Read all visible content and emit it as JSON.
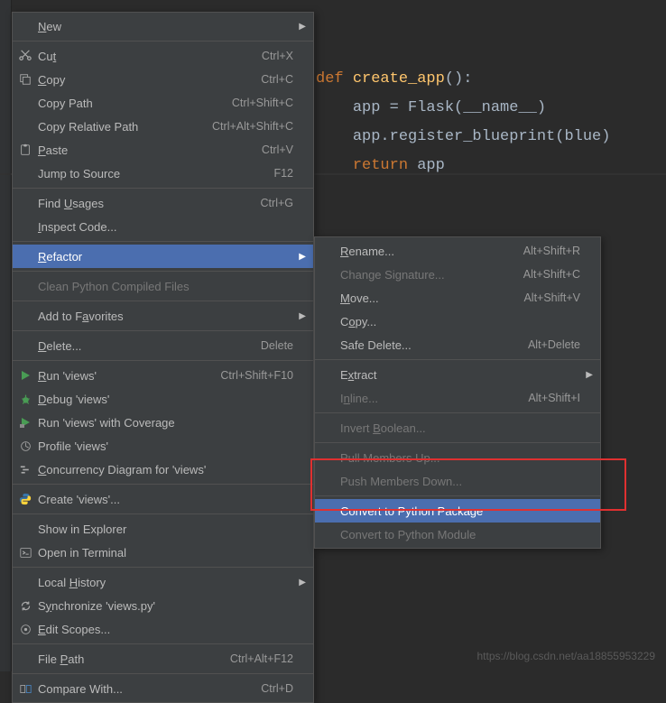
{
  "code": {
    "def": "def",
    "fname": "create_app",
    "line2_a": "app = Flask(",
    "line2_b": "__name__",
    "line2_c": ")",
    "line3": "app.register_blueprint(blue)",
    "ret": "return",
    "retval": "app"
  },
  "watermark": "https://blog.csdn.net/aa18855953229",
  "menu": {
    "new": "New",
    "cut": "Cut",
    "cut_sc": "Ctrl+X",
    "copy": "Copy",
    "copy_sc": "Ctrl+C",
    "copy_path": "Copy Path",
    "copy_path_sc": "Ctrl+Shift+C",
    "copy_rel": "Copy Relative Path",
    "copy_rel_sc": "Ctrl+Alt+Shift+C",
    "paste": "Paste",
    "paste_sc": "Ctrl+V",
    "jump": "Jump to Source",
    "jump_sc": "F12",
    "find_usages": "Find Usages",
    "find_usages_sc": "Ctrl+G",
    "inspect": "Inspect Code...",
    "refactor": "Refactor",
    "clean_pyc": "Clean Python Compiled Files",
    "add_fav": "Add to Favorites",
    "delete": "Delete...",
    "delete_sc": "Delete",
    "run": "Run 'views'",
    "run_sc": "Ctrl+Shift+F10",
    "debug": "Debug 'views'",
    "run_cov": "Run 'views' with Coverage",
    "profile": "Profile 'views'",
    "concurrency": "Concurrency Diagram for 'views'",
    "create": "Create 'views'...",
    "show_explorer": "Show in Explorer",
    "open_terminal": "Open in Terminal",
    "local_history": "Local History",
    "sync": "Synchronize 'views.py'",
    "edit_scopes": "Edit Scopes...",
    "file_path": "File Path",
    "file_path_sc": "Ctrl+Alt+F12",
    "compare_with": "Compare With...",
    "compare_with_sc": "Ctrl+D"
  },
  "submenu": {
    "rename": "Rename...",
    "rename_sc": "Alt+Shift+R",
    "change_sig": "Change Signature...",
    "change_sig_sc": "Alt+Shift+C",
    "move": "Move...",
    "move_sc": "Alt+Shift+V",
    "copy": "Copy...",
    "safe_delete": "Safe Delete...",
    "safe_delete_sc": "Alt+Delete",
    "extract": "Extract",
    "inline": "Inline...",
    "inline_sc": "Alt+Shift+I",
    "invert_bool": "Invert Boolean...",
    "pull_up": "Pull Members Up...",
    "push_down": "Push Members Down...",
    "to_package": "Convert to Python Package",
    "to_module": "Convert to Python Module"
  }
}
